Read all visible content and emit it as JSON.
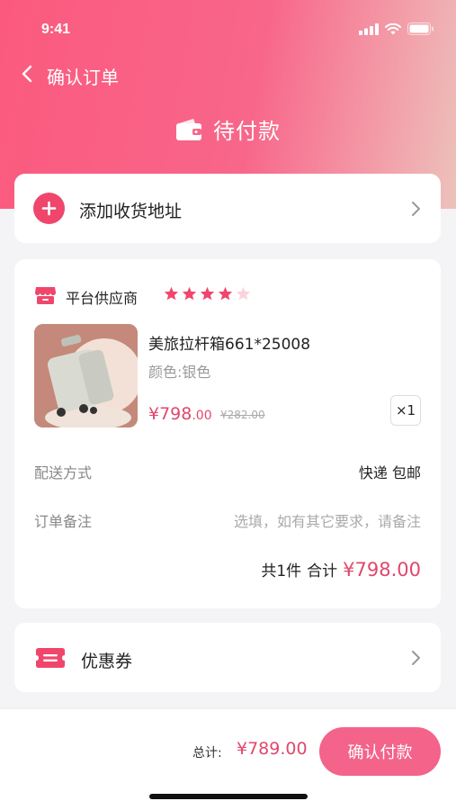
{
  "status_bar": {
    "time": "9:41"
  },
  "nav": {
    "title": "确认订单"
  },
  "page": {
    "status_title": "待付款"
  },
  "address": {
    "label": "添加收货地址"
  },
  "order": {
    "supplier": "平台供应商",
    "rating": 4,
    "rating_max": 5,
    "product": {
      "name": "美旅拉杆箱661*25008",
      "spec": "颜色:银色",
      "price_int": "¥798",
      "price_dec": ".00",
      "old_price": "¥282.00",
      "qty": "×1"
    },
    "delivery_label": "配送方式",
    "delivery_value": "快递 包邮",
    "remark_label": "订单备注",
    "remark_placeholder": "选填，如有其它要求，请备注",
    "total_count": "共1件",
    "total_label": "合计",
    "total_amount": "¥798.00"
  },
  "coupon": {
    "label": "优惠券"
  },
  "footer": {
    "sum_label": "总计:",
    "sum_amount": "¥789.00",
    "pay_button": "确认付款"
  },
  "colors": {
    "accent": "#f0466c",
    "price": "#e0476c",
    "gradient_start": "#fb5a7e",
    "gradient_end": "#ecc2bc"
  }
}
